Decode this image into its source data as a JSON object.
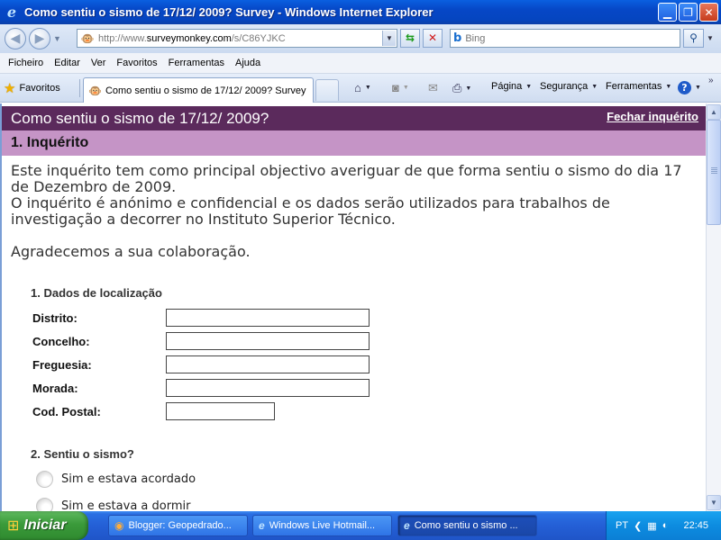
{
  "window": {
    "title": "Como sentiu o sismo de 17/12/ 2009? Survey - Windows Internet Explorer",
    "controls": [
      "minimize",
      "maximize",
      "close"
    ]
  },
  "addressbar": {
    "url_prefix": "http://www.",
    "url_host": "surveymonkey.com",
    "url_path": "/s/C86YJKC",
    "search_placeholder": "Bing"
  },
  "menubar": {
    "items": [
      "Ficheiro",
      "Editar",
      "Ver",
      "Favoritos",
      "Ferramentas",
      "Ajuda"
    ]
  },
  "commandbar": {
    "favorites_label": "Favoritos",
    "active_tab": "Como sentiu o sismo de 17/12/ 2009? Survey",
    "page_menu": "Página",
    "safety_menu": "Segurança",
    "tools_menu": "Ferramentas"
  },
  "survey": {
    "title": "Como sentiu o sismo de 17/12/ 2009?",
    "exit_link": "Fechar inquérito",
    "page_title": "1. Inquérito",
    "intro_line1": "Este inquérito tem como principal objectivo averiguar de que forma sentiu o sismo do dia 17 de Dezembro de 2009.",
    "intro_line2": "O inquérito é anónimo e confidencial e os dados serão utilizados para trabalhos de investigação a decorrer no Instituto Superior Técnico.",
    "intro_line3": "Agradecemos a sua colaboração.",
    "q1": {
      "title": "1. Dados de localização",
      "fields": [
        {
          "label": "Distrito:",
          "value": ""
        },
        {
          "label": "Concelho:",
          "value": ""
        },
        {
          "label": "Freguesia:",
          "value": ""
        },
        {
          "label": "Morada:",
          "value": ""
        },
        {
          "label": "Cod. Postal:",
          "value": ""
        }
      ]
    },
    "q2": {
      "title": "2. Sentiu o sismo?",
      "options": [
        "Sim e estava acordado",
        "Sim e estava a dormir"
      ]
    }
  },
  "taskbar": {
    "start_label": "Iniciar",
    "tasks": [
      "Blogger: Geopedrado...",
      "Windows Live Hotmail...",
      "Como sentiu o sismo ..."
    ],
    "language": "PT",
    "clock": "22:45"
  }
}
